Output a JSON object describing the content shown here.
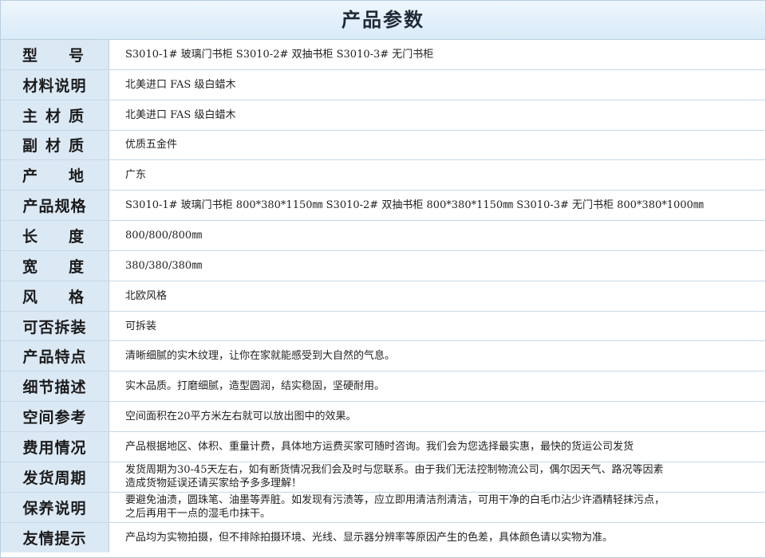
{
  "title": "产品参数",
  "rows": [
    {
      "label": "型号",
      "value": "S3010-1# 玻璃门书柜  S3010-2# 双抽书柜  S3010-3# 无门书柜"
    },
    {
      "label": "材料说明",
      "value": "北美进口 FAS 级白蜡木"
    },
    {
      "label": "主材质",
      "value": "北美进口 FAS 级白蜡木"
    },
    {
      "label": "副材质",
      "value": "优质五金件"
    },
    {
      "label": "产地",
      "value": "广东"
    },
    {
      "label": "产品规格",
      "value": "S3010-1# 玻璃门书柜 800*380*1150㎜  S3010-2# 双抽书柜 800*380*1150㎜  S3010-3# 无门书柜 800*380*1000㎜"
    },
    {
      "label": "长度",
      "value": "800/800/800㎜"
    },
    {
      "label": "宽度",
      "value": "380/380/380㎜"
    },
    {
      "label": "风格",
      "value": "北欧风格"
    },
    {
      "label": "可否拆装",
      "value": "可拆装"
    },
    {
      "label": "产品特点",
      "value": "清晰细腻的实木纹理，让你在家就能感受到大自然的气息。"
    },
    {
      "label": "细节描述",
      "value": "实木品质。打磨细腻，造型圆润，结实稳固，坚硬耐用。"
    },
    {
      "label": "空间参考",
      "value": "空间面积在20平方米左右就可以放出图中的效果。"
    },
    {
      "label": "费用情况",
      "value": "产品根据地区、体积、重量计费，具体地方运费买家可随时咨询。我们会为您选择最实惠，最快的货运公司发货"
    },
    {
      "label": "发货周期",
      "value": "发货周期为30-45天左右，如有断货情况我们会及时与您联系。由于我们无法控制物流公司，偶尔因天气、路况等因素\n造成货物延误还请买家给予多多理解！"
    },
    {
      "label": "保养说明",
      "value": "要避免油渍，圆珠笔、油墨等弄脏。如发现有污渍等，应立即用清洁剂清洁，可用干净的白毛巾沾少许酒精轻抹污点，\n之后再用干一点的湿毛巾抹干。"
    },
    {
      "label": "友情提示",
      "value": "产品均为实物拍摄，但不排除拍摄环境、光线、显示器分辨率等原因产生的色差，具体颜色请以实物为准。"
    }
  ]
}
